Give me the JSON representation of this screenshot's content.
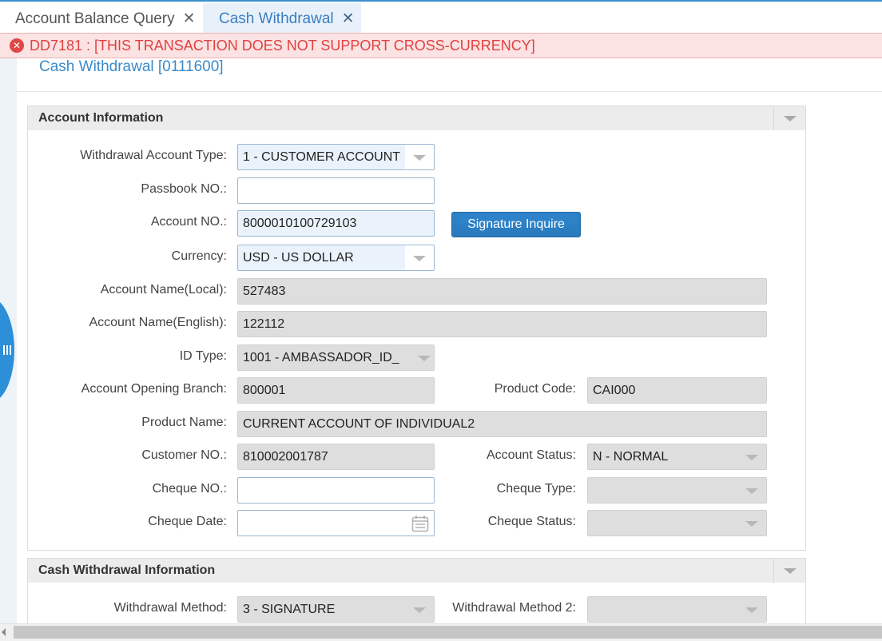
{
  "tabs": [
    {
      "label": "Account Balance Query",
      "close": "✕"
    },
    {
      "label": "Cash Withdrawal",
      "close": "✕"
    }
  ],
  "error": {
    "icon": "close-circle-icon",
    "text": "DD7181 : [THIS TRANSACTION DOES NOT SUPPORT CROSS-CURRENCY]",
    "color": "#e24040"
  },
  "page_title": "Cash Withdrawal [0111600]",
  "account_info": {
    "title": "Account Information",
    "withdrawal_account_type": {
      "label": "Withdrawal Account Type:",
      "value": "1 - CUSTOMER ACCOUNT"
    },
    "passbook_no": {
      "label": "Passbook NO.:",
      "value": ""
    },
    "account_no": {
      "label": "Account NO.:",
      "value": "8000010100729103"
    },
    "signature_button": "Signature Inquire",
    "currency": {
      "label": "Currency:",
      "value": "USD - US DOLLAR"
    },
    "account_name_local": {
      "label": "Account Name(Local):",
      "value": "527483"
    },
    "account_name_english": {
      "label": "Account Name(English):",
      "value": "122112"
    },
    "id_type": {
      "label": "ID Type:",
      "value": "1001 - AMBASSADOR_ID_"
    },
    "opening_branch": {
      "label": "Account Opening Branch:",
      "value": "800001"
    },
    "product_code": {
      "label": "Product Code:",
      "value": "CAI000"
    },
    "product_name": {
      "label": "Product Name:",
      "value": "CURRENT ACCOUNT OF INDIVIDUAL2"
    },
    "customer_no": {
      "label": "Customer NO.:",
      "value": "810002001787"
    },
    "account_status": {
      "label": "Account Status:",
      "value": "N - NORMAL"
    },
    "cheque_no": {
      "label": "Cheque NO.:",
      "value": ""
    },
    "cheque_type": {
      "label": "Cheque Type:",
      "value": ""
    },
    "cheque_date": {
      "label": "Cheque Date:",
      "value": ""
    },
    "cheque_status": {
      "label": "Cheque Status:",
      "value": ""
    }
  },
  "cash_info": {
    "title": "Cash Withdrawal Information",
    "withdrawal_method": {
      "label": "Withdrawal Method:",
      "value": "3 - SIGNATURE"
    },
    "withdrawal_method_2": {
      "label": "Withdrawal Method 2:",
      "value": ""
    }
  },
  "colors": {
    "accent": "#2d82c8",
    "error_bg": "#fbe3e3",
    "readonly_bg": "#dedede"
  }
}
